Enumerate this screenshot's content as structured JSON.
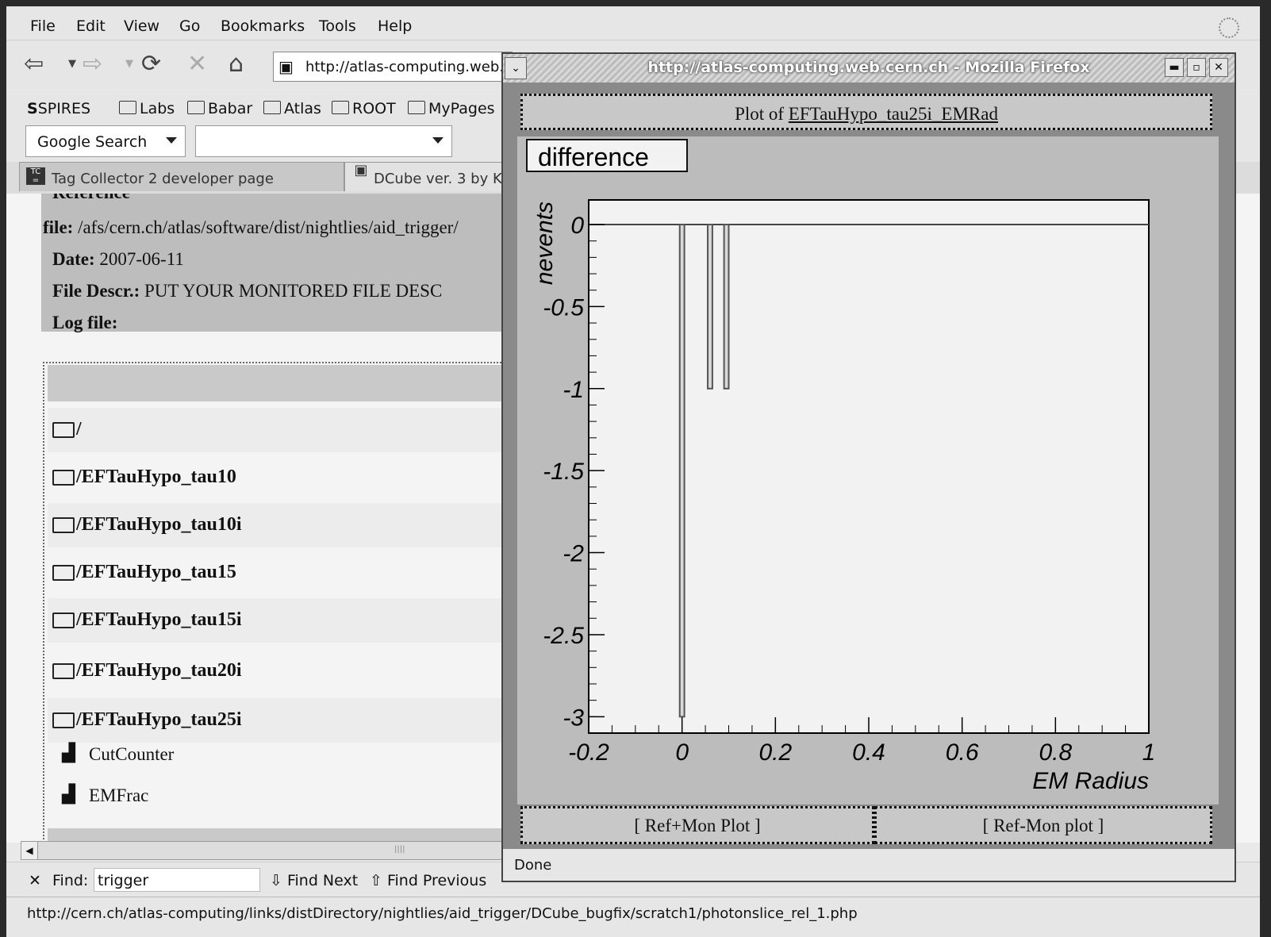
{
  "main": {
    "menu": [
      "File",
      "Edit",
      "View",
      "Go",
      "Bookmarks",
      "Tools",
      "Help"
    ],
    "url": "http://atlas-computing.web.c",
    "bookmarks": [
      "SPIRES",
      "Labs",
      "Babar",
      "Atlas",
      "ROOT",
      "MyPages"
    ],
    "search_engine": "Google Search",
    "tabs": [
      "Tag Collector 2 developer page",
      "DCube ver. 3 by K"
    ],
    "reference": {
      "heading": "Reference",
      "file_label": "file:",
      "file_value": "/afs/cern.ch/atlas/software/dist/nightlies/aid_trigger/",
      "date_label": "Date:",
      "date_value": "2007-06-11",
      "descr_label": "File Descr.:",
      "descr_value": "PUT YOUR MONITORED FILE DESC",
      "log_label": "Log file:"
    },
    "directories": [
      "/",
      "/EFTauHypo_tau10",
      "/EFTauHypo_tau10i",
      "/EFTauHypo_tau15",
      "/EFTauHypo_tau15i",
      "/EFTauHypo_tau20i",
      "/EFTauHypo_tau25i"
    ],
    "histograms": [
      "CutCounter",
      "EMFrac"
    ],
    "findbar": {
      "label": "Find:",
      "value": "trigger",
      "next": "Find Next",
      "previous": "Find Previous"
    },
    "status": "http://cern.ch/atlas-computing/links/distDirectory/nightlies/aid_trigger/DCube_bugfix/scratch1/photonslice_rel_1.php"
  },
  "popup": {
    "title": "http://atlas-computing.web.cern.ch - Mozilla Firefox",
    "plot_prefix": "Plot of",
    "plot_name": "EFTauHypo_tau25i_EMRad",
    "footer_left": "[ Ref+Mon Plot ]",
    "footer_right": "[ Ref-Mon plot ]",
    "status": "Done"
  },
  "chart_data": {
    "type": "bar",
    "title": "difference",
    "xlabel": "EM Radius",
    "ylabel": "nevents",
    "xlim": [
      -0.2,
      1.0
    ],
    "ylim": [
      -3.1,
      0.15
    ],
    "x_ticks": [
      "-0.2",
      "0",
      "0.2",
      "0.4",
      "0.6",
      "0.8",
      "1"
    ],
    "y_ticks": [
      "0",
      "-0.5",
      "-1",
      "-1.5",
      "-2",
      "-2.5",
      "-3"
    ],
    "bars": [
      {
        "x0": -0.005,
        "x1": 0.005,
        "value": -3
      },
      {
        "x0": 0.055,
        "x1": 0.065,
        "value": -1
      },
      {
        "x0": 0.09,
        "x1": 0.1,
        "value": -1
      }
    ]
  }
}
